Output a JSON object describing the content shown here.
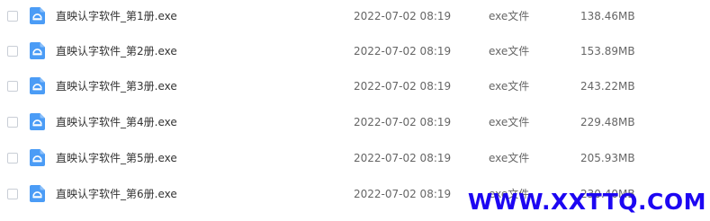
{
  "colors": {
    "icon_blue": "#4B9CF6",
    "watermark": "#1d06f2"
  },
  "icon": "exe-file-icon",
  "files": [
    {
      "name": "直映认字软件_第1册.exe",
      "date": "2022-07-02 08:19",
      "type": "exe文件",
      "size": "138.46MB"
    },
    {
      "name": "直映认字软件_第2册.exe",
      "date": "2022-07-02 08:19",
      "type": "exe文件",
      "size": "153.89MB"
    },
    {
      "name": "直映认字软件_第3册.exe",
      "date": "2022-07-02 08:19",
      "type": "exe文件",
      "size": "243.22MB"
    },
    {
      "name": "直映认字软件_第4册.exe",
      "date": "2022-07-02 08:19",
      "type": "exe文件",
      "size": "229.48MB"
    },
    {
      "name": "直映认字软件_第5册.exe",
      "date": "2022-07-02 08:19",
      "type": "exe文件",
      "size": "205.93MB"
    },
    {
      "name": "直映认字软件_第6册.exe",
      "date": "2022-07-02 08:19",
      "type": "exe文件",
      "size": "230.40MB"
    }
  ],
  "watermark": "WWW.XXTTQ.COM"
}
